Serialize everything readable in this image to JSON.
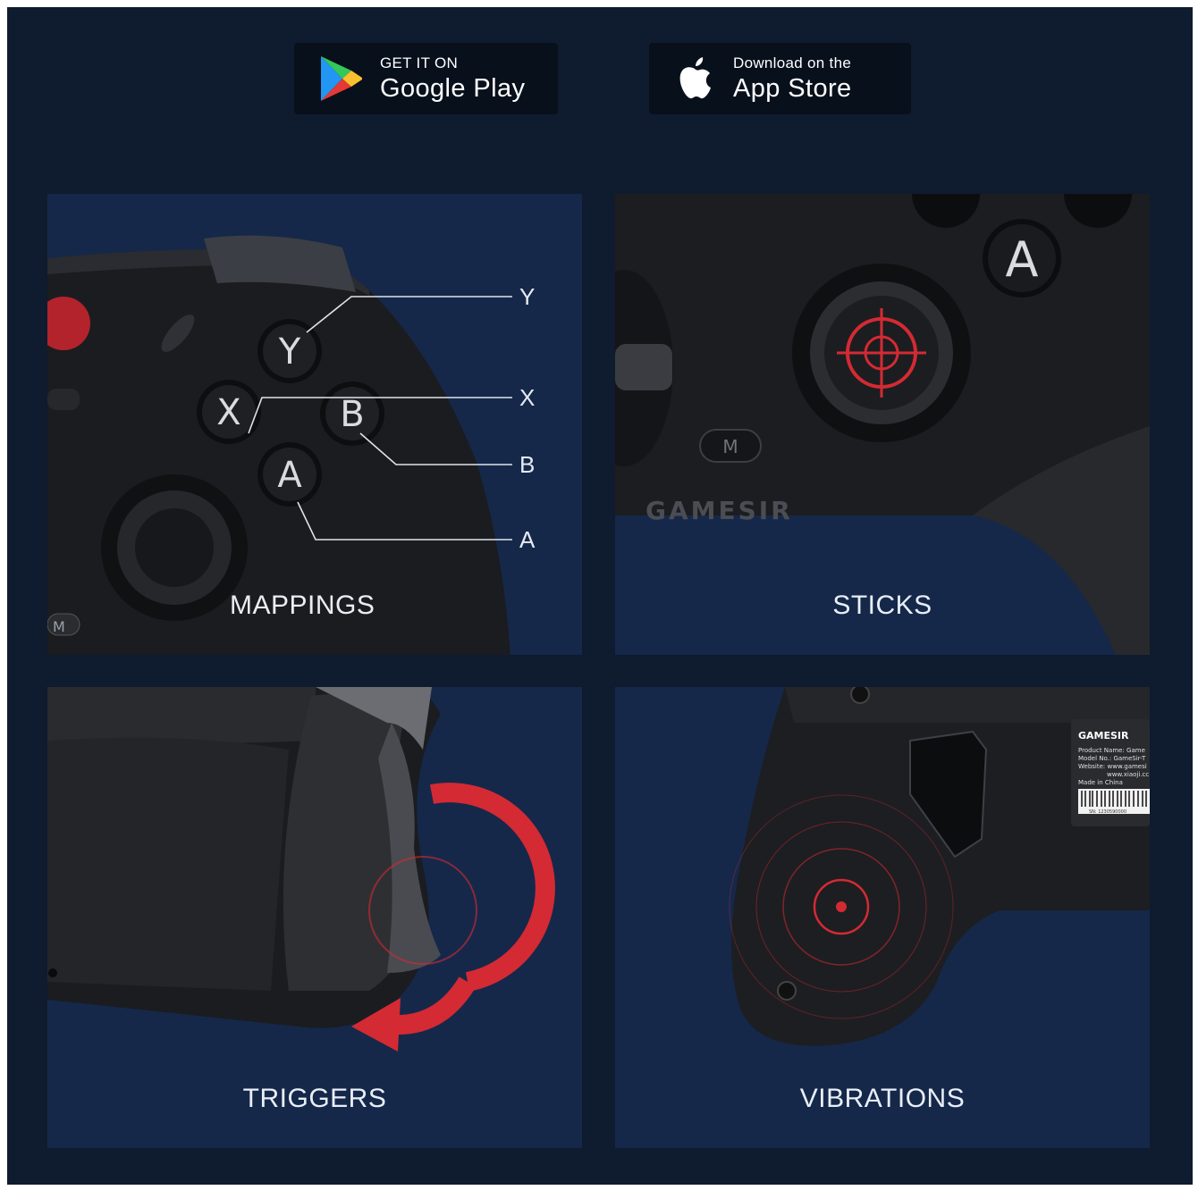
{
  "store_badges": {
    "google": {
      "small": "GET IT ON",
      "large": "Google Play",
      "icon": "google-play-icon"
    },
    "apple": {
      "small": "Download on the",
      "large": "App Store",
      "icon": "apple-icon"
    }
  },
  "panels": {
    "mappings": {
      "label": "MAPPINGS",
      "callouts": [
        "Y",
        "X",
        "B",
        "A"
      ],
      "buttons": {
        "y": "Y",
        "x": "X",
        "b": "B",
        "a": "A"
      },
      "small_button": "M"
    },
    "sticks": {
      "label": "STICKS",
      "button_a": "A",
      "button_m": "M",
      "brand": "GAMESIR"
    },
    "triggers": {
      "label": "TRIGGERS"
    },
    "vibrations": {
      "label": "VIBRATIONS",
      "sticker": {
        "brand": "GAMESIR",
        "lines": [
          "Product Name: Game",
          "Model No.: GameSir-T",
          "Website: www.gamesi",
          "www.xiaoji.cc",
          "Made in China"
        ],
        "serial": "SN: 1230590000"
      }
    }
  },
  "colors": {
    "background": "#0f1b2e",
    "panel": "#15284a",
    "accent_red": "#d42a33",
    "badge": "#08101c"
  }
}
